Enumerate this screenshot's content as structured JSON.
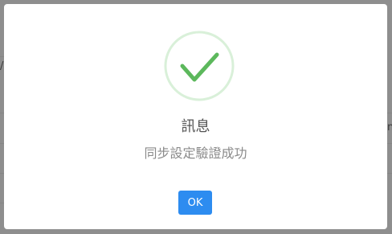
{
  "dialog": {
    "icon": "success-check-icon",
    "title": "訊息",
    "message": "同步設定驗證成功",
    "ok_label": "OK"
  },
  "colors": {
    "success_ring": "#d9f0d9",
    "success_check": "#5cb85c",
    "ok_button": "#2d8cf0",
    "overlay": "#8e8e8e"
  }
}
